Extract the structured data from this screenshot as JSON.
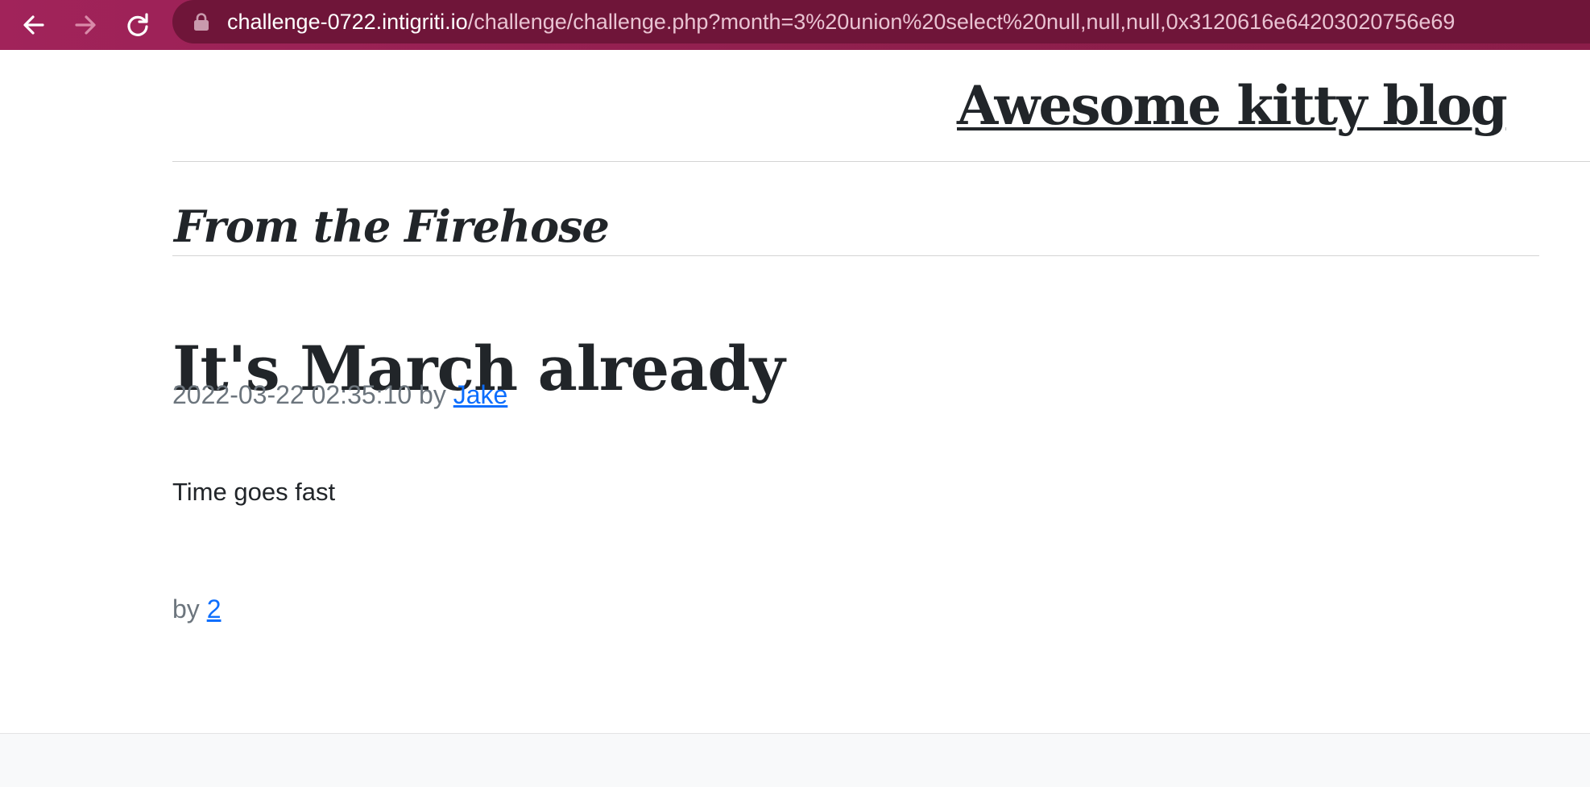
{
  "browser": {
    "url_host": "challenge-0722.intigriti.io",
    "url_path": "/challenge/challenge.php?month=3%20union%20select%20null,null,null,0x3120616e64203020756e69"
  },
  "blog": {
    "title": "Awesome kitty blog",
    "section_heading": "From the Firehose"
  },
  "posts": [
    {
      "title": "It's March already",
      "date": "2022-03-22 02:35:10",
      "by_label": "by",
      "author": "Jake",
      "body": "Time goes fast"
    },
    {
      "by_label": "by",
      "author": "2"
    }
  ],
  "colors": {
    "browser_bar": "#95204f",
    "omnibox": "#6f1539",
    "link": "#0d6efd",
    "meta_text": "#6c757d",
    "heading_text": "#212529"
  }
}
